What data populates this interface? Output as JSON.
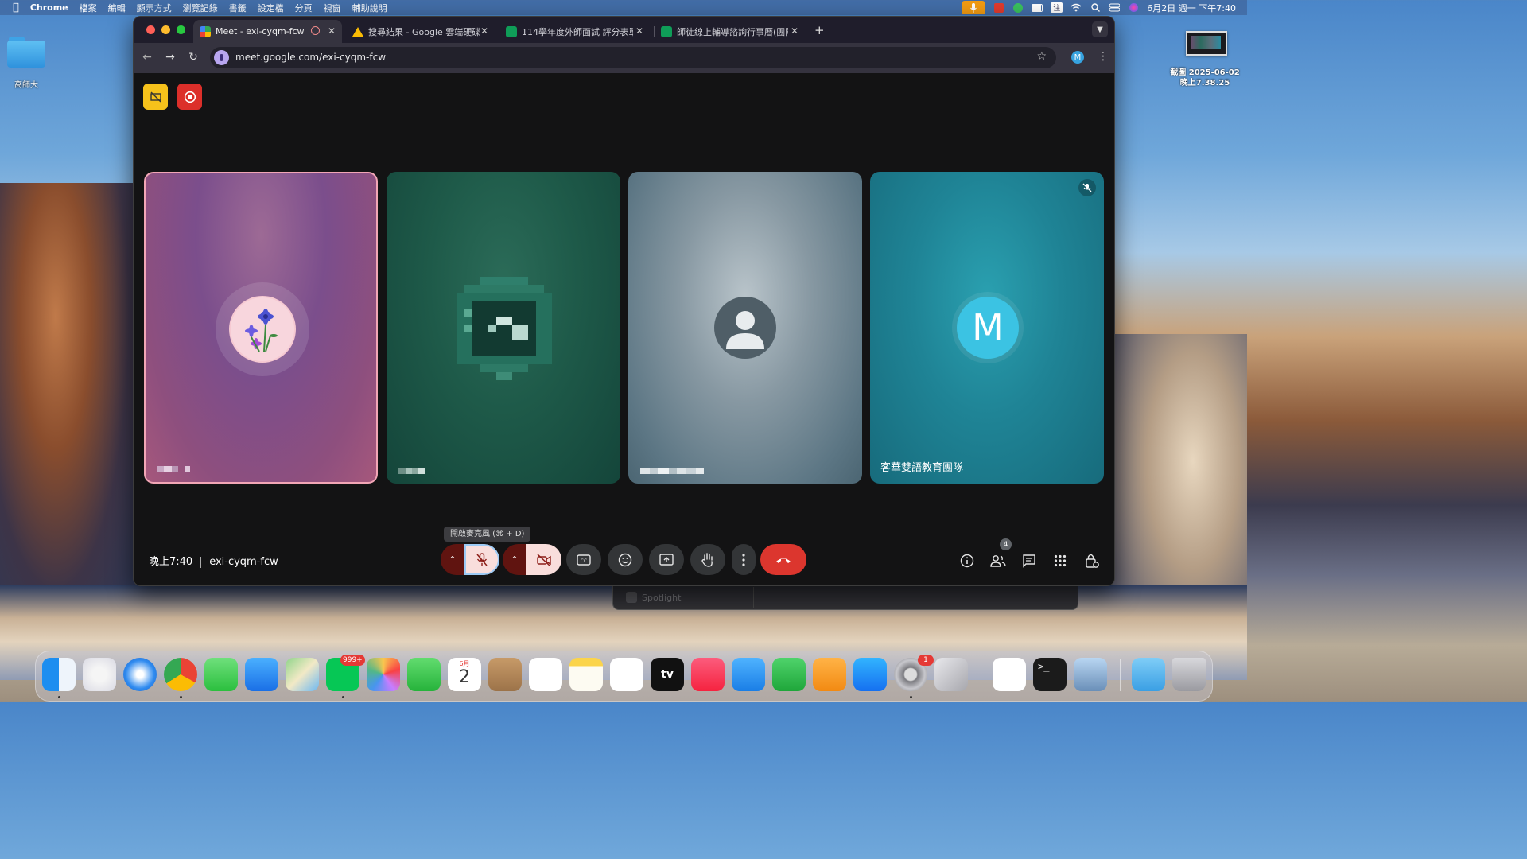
{
  "menubar": {
    "app_name": "Chrome",
    "menus": [
      "檔案",
      "編輯",
      "顯示方式",
      "瀏覽記錄",
      "書籤",
      "設定檔",
      "分頁",
      "視窗",
      "輔助說明"
    ],
    "input_method": "注",
    "datetime": "6月2日 週一 下午7:40"
  },
  "desktop": {
    "folder_label": "高師大",
    "screenshot_label_line1": "截圖 2025-06-02",
    "screenshot_label_line2": "晚上7.38.25"
  },
  "browser": {
    "tabs": [
      {
        "title": "Meet - exi-cyqm-fcw",
        "active": true,
        "favicon_color": "#34a853"
      },
      {
        "title": "搜尋結果 - Google 雲端硬碟",
        "active": false,
        "favicon_color": "#fbbc04"
      },
      {
        "title": "114學年度外師面試 評分表單 (E",
        "active": false,
        "favicon_color": "#0f9d58"
      },
      {
        "title": "師徒線上輔導諮詢行事曆(團隊內",
        "active": false,
        "favicon_color": "#0f9d58"
      }
    ],
    "close_glyph": "✕",
    "new_tab_glyph": "+",
    "url": "meet.google.com/exi-cyqm-fcw",
    "profile_initial": "M"
  },
  "meet": {
    "participants": [
      {
        "name": "",
        "name_pixelated": true,
        "avatar": "flower-photo",
        "speaking": true
      },
      {
        "name": "",
        "name_pixelated": true,
        "avatar": "pixelated-photo"
      },
      {
        "name": "",
        "name_pixelated": true,
        "avatar": "default-person"
      },
      {
        "name": "客華雙語教育團隊",
        "avatar_initial": "M",
        "muted": true
      }
    ],
    "time": "晚上7:40",
    "meeting_code": "exi-cyqm-fcw",
    "tooltip": "開啟麥克風 (⌘ + D)",
    "people_count": "4",
    "colors": {
      "tile1": "#8e4f7e",
      "tile2": "#1d5c4a",
      "tile3": "#5c7684",
      "tile4": "#1f8496",
      "hangup": "#dc362e",
      "speaking_border": "#f2a6b6"
    }
  },
  "spotlight": {
    "placeholder": "Spotlight"
  },
  "dock": {
    "apps": [
      "finder",
      "launchpad",
      "safari",
      "chrome",
      "messages",
      "mail",
      "maps",
      "line",
      "photos",
      "facetime",
      "calendar",
      "contacts",
      "reminders",
      "notes",
      "freeform",
      "tv",
      "music",
      "keynote",
      "numbers",
      "pages",
      "app-store",
      "system-settings",
      "iphone-mirroring",
      "windows-app",
      "terminal",
      "preview",
      "downloads",
      "trash"
    ],
    "line_badge": "999+",
    "settings_badge": "1",
    "calendar_month": "6月",
    "calendar_day": "2",
    "tv_label": "tv"
  }
}
